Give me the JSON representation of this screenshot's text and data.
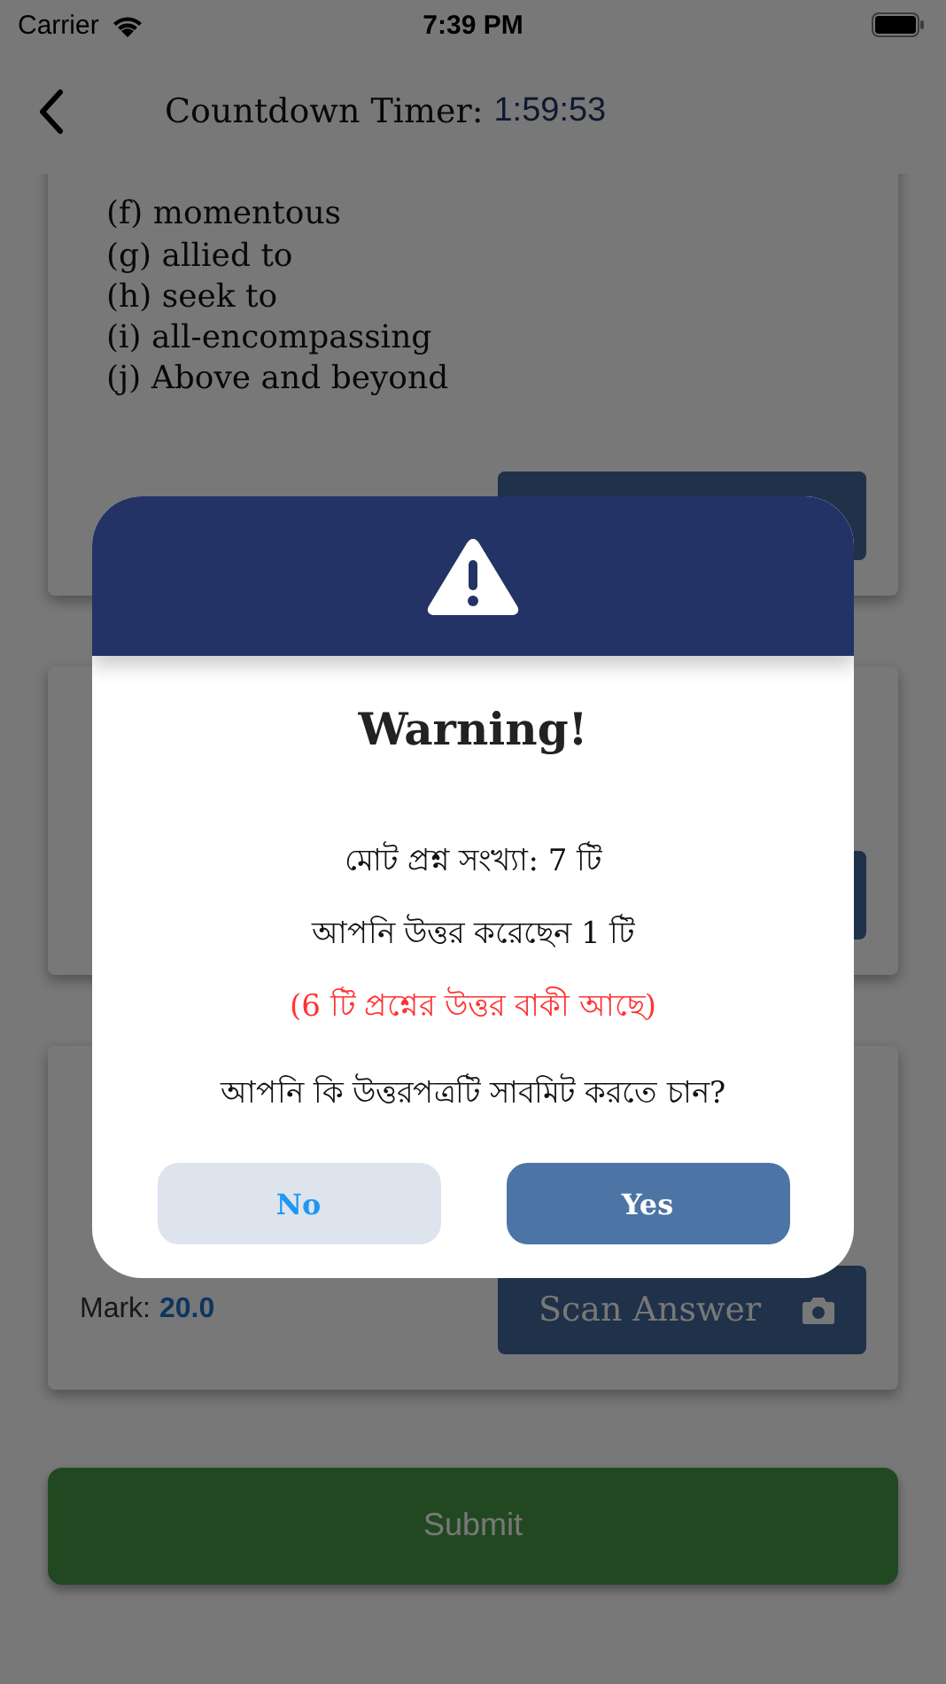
{
  "status_bar": {
    "carrier": "Carrier",
    "time": "7:39 PM"
  },
  "header": {
    "title": "Countdown Timer:",
    "timer": "1:59:53"
  },
  "cards": [
    {
      "kind": "options",
      "items": [
        "(f) momentous",
        "(g) allied to",
        "(h) seek to",
        "(i) all-encompassing",
        "(j) Above and beyond"
      ]
    },
    {
      "kind": "covered"
    },
    {
      "kind": "scan",
      "mark_label": "Mark:",
      "mark_value": "20.0",
      "button": "Scan Answer"
    }
  ],
  "submit_button": "Submit",
  "dialog": {
    "title": "Warning!",
    "lines": [
      {
        "text": "মোট প্রশ্ন সংখ্যা: 7 টি",
        "kind": "normal"
      },
      {
        "text": "আপনি উত্তর করেছেন 1 টি",
        "kind": "normal"
      },
      {
        "text": "(6 টি প্রশ্নের উত্তর বাকী আছে)",
        "kind": "alert"
      }
    ],
    "question": "আপনি কি উত্তরপত্রটি সাবমিট করতে চান?",
    "buttons": [
      {
        "label": "No",
        "kind": "secondary"
      },
      {
        "label": "Yes",
        "kind": "primary"
      }
    ]
  }
}
